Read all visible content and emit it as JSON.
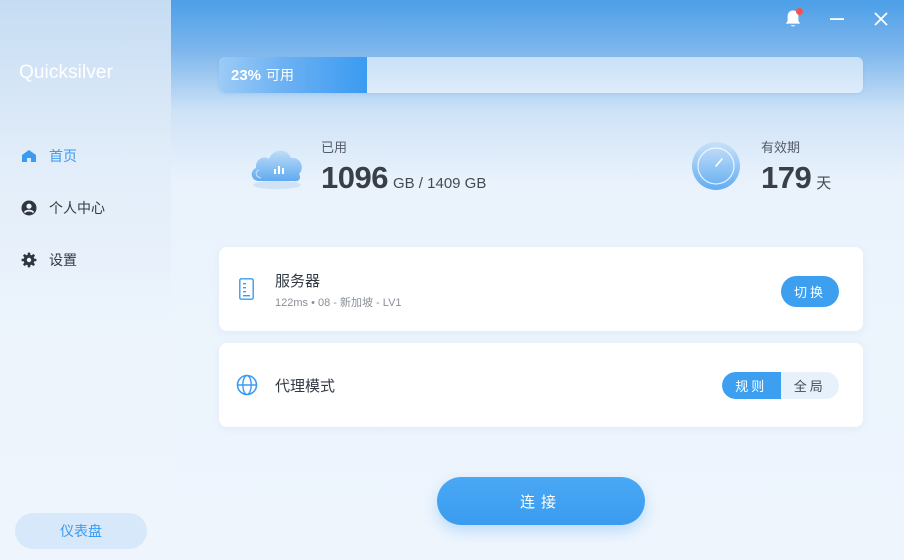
{
  "app": {
    "title": "Quicksilver"
  },
  "sidebar": {
    "items": [
      {
        "label": "首页",
        "icon": "home-icon",
        "active": true
      },
      {
        "label": "个人中心",
        "icon": "user-icon",
        "active": false
      },
      {
        "label": "设置",
        "icon": "gear-icon",
        "active": false
      }
    ],
    "dashboard_label": "仪表盘"
  },
  "window": {
    "notification_icon": "bell-icon",
    "has_notification": true,
    "minimize_icon": "minus-icon",
    "close_icon": "close-icon"
  },
  "usage": {
    "percent": 23,
    "percent_text": "23%",
    "available_label": "可用"
  },
  "stats": {
    "used_label": "已用",
    "used_value": "1096",
    "used_unit": "GB / 1409 GB",
    "expiry_label": "有效期",
    "expiry_value": "179",
    "expiry_unit": "天"
  },
  "server": {
    "title": "服务器",
    "detail": "122ms • 08 - 新加坡 - LV1",
    "switch_label": "切换"
  },
  "proxy": {
    "title": "代理模式",
    "options": [
      "规则",
      "全局"
    ],
    "selected": "规则"
  },
  "connect_label": "连接",
  "colors": {
    "accent": "#3b9bf1",
    "sidebar_active": "#3b9bf1",
    "notification_dot": "#f25454"
  }
}
